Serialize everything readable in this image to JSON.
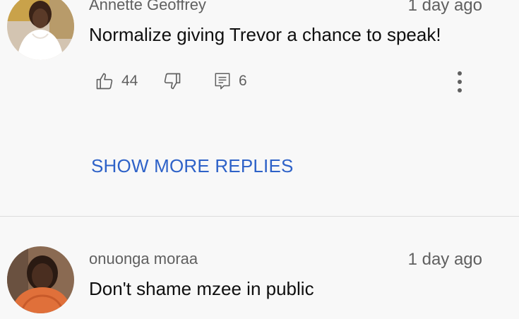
{
  "comments": [
    {
      "author": "Annette Geoffrey",
      "timestamp": "1 day ago",
      "text": "Normalize giving Trevor a chance to speak!",
      "likes": "44",
      "replies": "6",
      "show_more_label": "SHOW MORE REPLIES",
      "icons": [
        "thumbs-up-icon",
        "thumbs-down-icon",
        "reply-icon",
        "more-options-icon"
      ]
    },
    {
      "author": "onuonga moraa",
      "timestamp": "1 day ago",
      "text": "Don't shame mzee in public"
    }
  ],
  "colors": {
    "background": "#f8f8f8",
    "primary_text": "#0f0f0f",
    "secondary_text": "#606060",
    "link_blue": "#2e62c8",
    "divider": "#dcdcdc"
  }
}
